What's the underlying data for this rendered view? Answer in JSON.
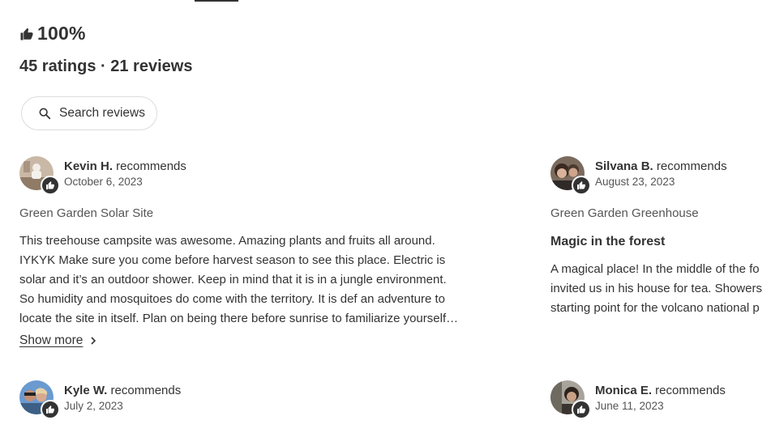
{
  "summary": {
    "rating_percent": "100%",
    "counts": "45 ratings · 21 reviews"
  },
  "search": {
    "label": "Search reviews"
  },
  "reviews": [
    {
      "name": "Kevin H.",
      "action": " recommends",
      "date": "October 6, 2023",
      "site": "Green Garden Solar Site",
      "title": "",
      "body": "This treehouse campsite was awesome. Amazing plants and fruits all around.\nIYKYK Make sure you come before harvest season to see this place. Electric is\nsolar and it’s an outdoor shower. Keep in mind that it is in a jungle environment.\nSo humidity and mosquitoes do come with the territory. It is def an adventure to\nlocate the site in itself. Plan on being there before sunrise to familiarize yourself…",
      "show_more": "Show more"
    },
    {
      "name": "Silvana B.",
      "action": " recommends",
      "date": "August 23, 2023",
      "site": "Green Garden Greenhouse",
      "title": "Magic in the forest",
      "body": "A magical place! In the middle of the fo\ninvited us in his house for tea. Showers\nstarting point for the volcano national p"
    },
    {
      "name": "Kyle W.",
      "action": " recommends",
      "date": "July 2, 2023"
    },
    {
      "name": "Monica E.",
      "action": " recommends",
      "date": "June 11, 2023"
    }
  ],
  "icons": {
    "thumbs_up": "thumbs-up-icon",
    "search": "search-icon",
    "chevron": "chevron-right-icon"
  },
  "colors": {
    "text": "#333333",
    "muted": "#555555",
    "border": "#dcdcdc"
  }
}
